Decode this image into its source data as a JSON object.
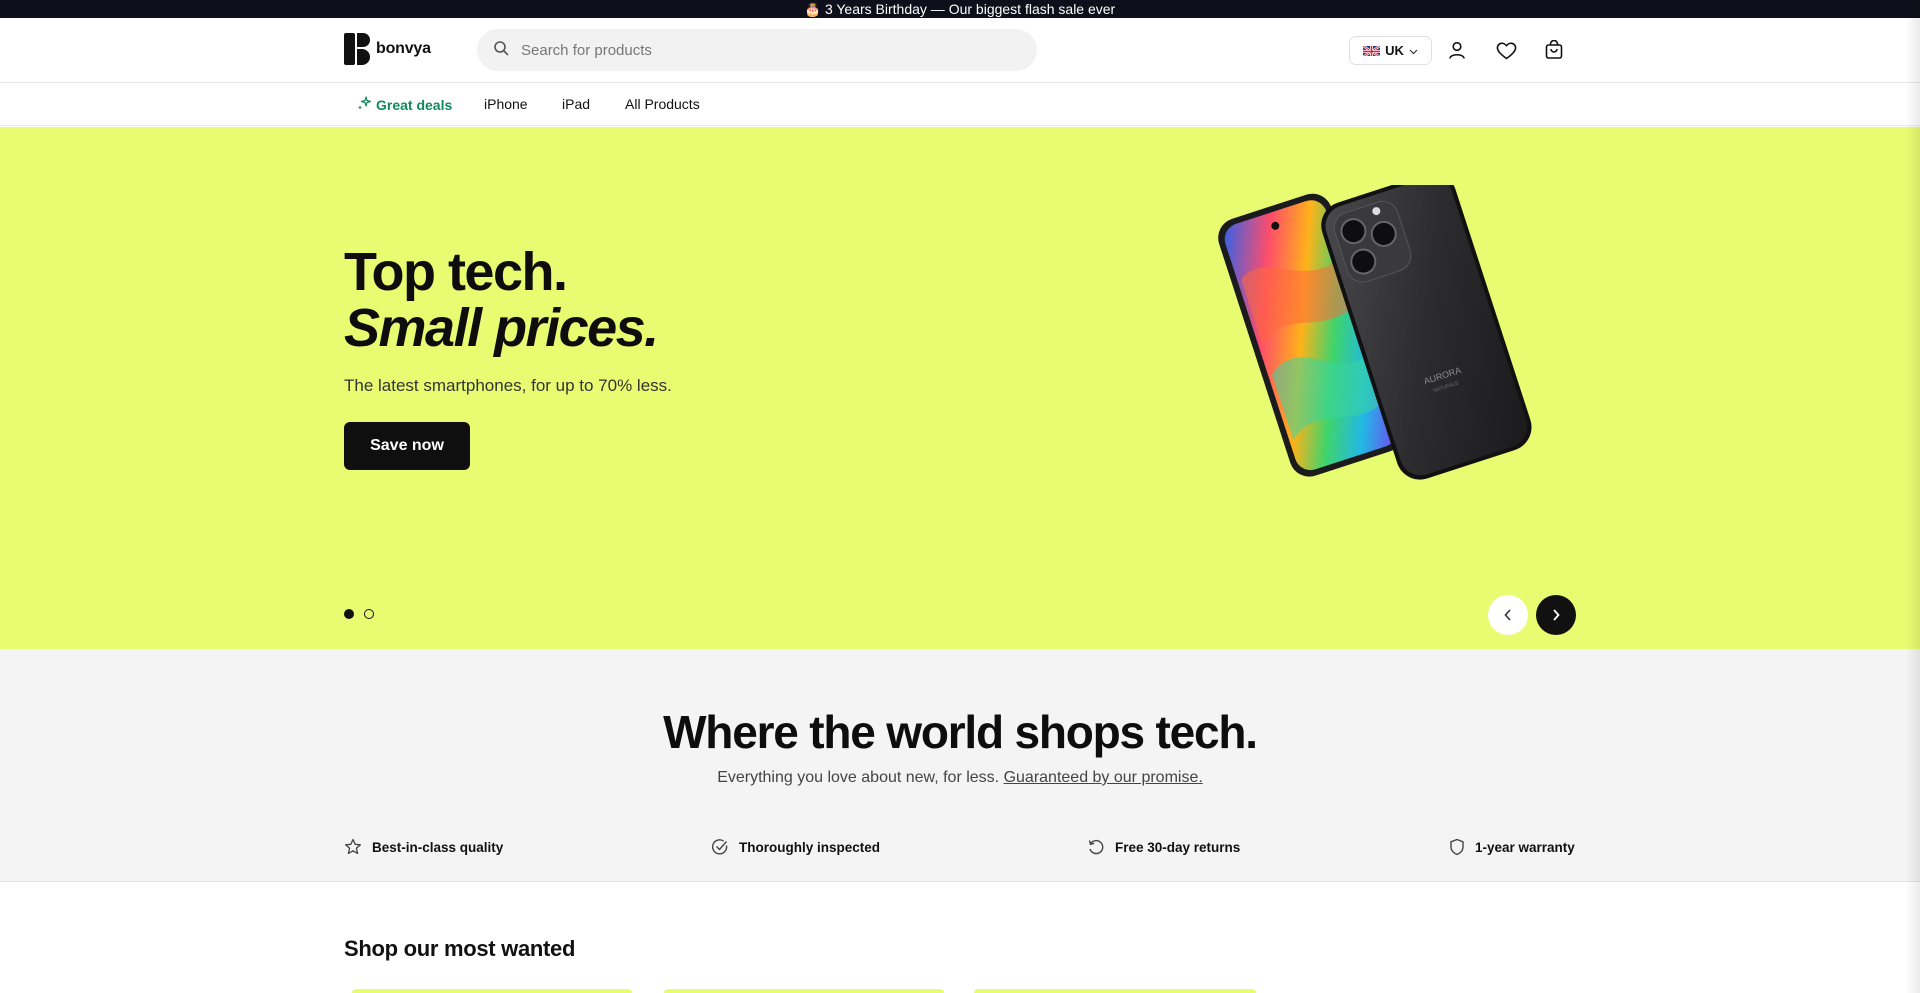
{
  "announcement": {
    "emoji": "🎂",
    "text": "3 Years Birthday — Our biggest flash sale ever"
  },
  "header": {
    "logo_text": "bonvya",
    "search_placeholder": "Search for products",
    "locale_label": "UK",
    "icons": [
      "account-icon",
      "heart-icon",
      "cart-icon"
    ]
  },
  "nav": {
    "items": [
      {
        "label": "Great deals",
        "icon": "sparkle-icon",
        "highlight_color": "#0f8a5b"
      },
      {
        "label": "iPhone"
      },
      {
        "label": "iPad"
      },
      {
        "label": "All Products"
      }
    ]
  },
  "hero": {
    "title_line1": "Top tech.",
    "title_line2": "Small prices.",
    "subtitle": "The latest smartphones, for up to 70% less.",
    "cta_label": "Save now",
    "background_color": "#e8fc72",
    "slides_total": 2,
    "active_slide": 1,
    "phone_brand": "AURORA",
    "phone_subtext": "NATURALE"
  },
  "tagline": {
    "title": "Where the world shops tech.",
    "text": "Everything you love about new, for less.",
    "link_text": "Guaranteed by our promise.",
    "features": [
      {
        "label": "Best-in-class quality",
        "icon": "star-icon"
      },
      {
        "label": "Thoroughly inspected",
        "icon": "check-circle-icon"
      },
      {
        "label": "Free 30-day returns",
        "icon": "return-icon"
      },
      {
        "label": "1-year warranty",
        "icon": "shield-icon"
      }
    ]
  },
  "most_wanted": {
    "title": "Shop our most wanted"
  }
}
